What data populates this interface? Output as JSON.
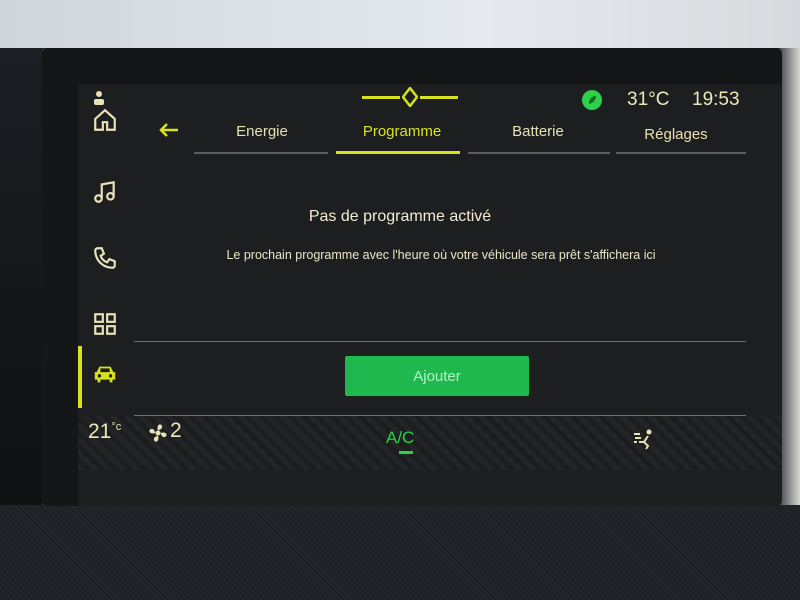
{
  "header": {
    "temperature": "31°C",
    "time": "19:53"
  },
  "rail": {
    "items": [
      {
        "icon": "home-icon"
      },
      {
        "icon": "music-icon"
      },
      {
        "icon": "phone-icon"
      },
      {
        "icon": "apps-grid-icon"
      },
      {
        "icon": "car-icon",
        "active": true
      }
    ]
  },
  "tabs": [
    {
      "label": "Energie"
    },
    {
      "label": "Programme",
      "active": true
    },
    {
      "label": "Batterie"
    },
    {
      "label": "Réglages"
    }
  ],
  "content": {
    "title": "Pas de programme activé",
    "description": "Le prochain programme avec l'heure où votre véhicule sera prêt s'affichera ici",
    "add_button_label": "Ajouter"
  },
  "bottom_bar": {
    "cabin_temp": "21",
    "cabin_temp_unit": "°c",
    "fan_speed": "2",
    "ac_label": "A/C"
  },
  "colors": {
    "accent": "#d7e21f",
    "button_green": "#1fb84f",
    "ac_green": "#2fd04a"
  }
}
